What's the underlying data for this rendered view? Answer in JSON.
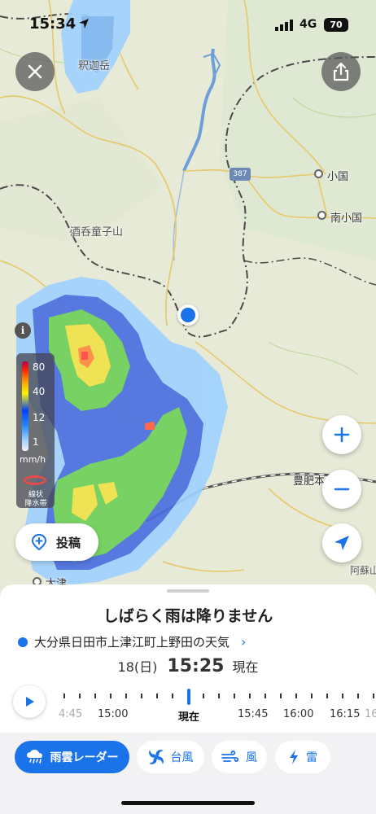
{
  "status_bar": {
    "time": "15:34",
    "network": "4G",
    "battery": "70"
  },
  "map": {
    "labels": {
      "mountain_top": "釈迦岳",
      "mountain_mid": "酒呑童子山",
      "city_right_top": "小国",
      "city_right_mid": "南小国",
      "city_bottom_left": "大津",
      "route_bottom": "豊肥本",
      "aso": "阿蘇山",
      "road_number": "387"
    },
    "legend": {
      "values": [
        "80",
        "40",
        "12",
        "1"
      ],
      "unit": "mm/h",
      "band_label_line1": "線状",
      "band_label_line2": "降水帯"
    },
    "info_icon_text": "i",
    "post_button_label": "投稿"
  },
  "sheet": {
    "headline": "しばらく雨は降りません",
    "place": "大分県日田市上津江町上野田の天気",
    "date": "18(日)",
    "time": "15:25",
    "now_label": "現在",
    "timeline_labels": [
      "4:45",
      "15:00",
      "現在",
      "15:45",
      "16:00",
      "16:15",
      "16"
    ]
  },
  "tabs": [
    {
      "label": "雨雲レーダー",
      "icon": "cloud-rain-icon",
      "active": true
    },
    {
      "label": "台風",
      "icon": "typhoon-icon",
      "active": false
    },
    {
      "label": "風",
      "icon": "wind-icon",
      "active": false
    },
    {
      "label": "雷",
      "icon": "lightning-icon",
      "active": false
    }
  ],
  "colors": {
    "accent": "#1a73e8",
    "rain_light": "#a0d2ff",
    "rain_mid": "#4a6fe0",
    "rain_green": "#6fcf5a",
    "rain_yellow": "#f0e24a",
    "rain_red": "#ff6040"
  }
}
